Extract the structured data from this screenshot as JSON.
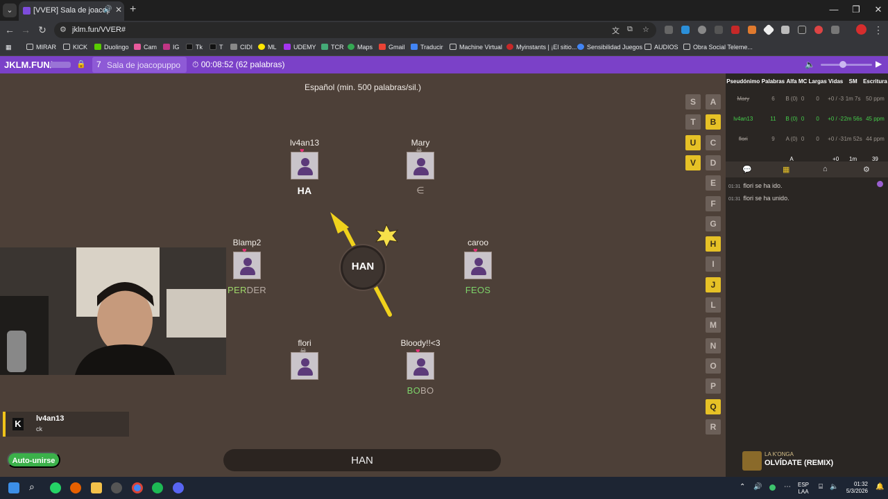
{
  "browser": {
    "tab_title": "[VVER] Sala de joacopuppo",
    "url": "jklm.fun/VVER#",
    "bookmarks": [
      "MIRAR",
      "KICK",
      "Duolingo",
      "Cam",
      "IG",
      "Tk",
      "T",
      "CIDI",
      "ML",
      "UDEMY",
      "TCR",
      "Maps",
      "Gmail",
      "Traducir",
      "Machine Virtual",
      "Myinstants | ¡El sitio...",
      "Sensibilidad Juegos",
      "AUDIOS",
      "Obra Social Teleme..."
    ]
  },
  "header": {
    "brand": "JKLM.FUN/",
    "room_number": "7",
    "room_name": "Sala de joacopuppo",
    "timer": "00:08:52 (62 palabras)"
  },
  "game": {
    "rule": "Español (min. 500 palabras/sil.)",
    "bomb_syllable": "HAN",
    "players": [
      {
        "name": "lv4an13",
        "status": "heart",
        "word_main": "HA",
        "word_rest": ""
      },
      {
        "name": "Mary",
        "status": "skull",
        "word_main": "",
        "word_rest": "∈"
      },
      {
        "name": "Blamp2",
        "status": "heart",
        "word_main": "PER",
        "word_rest": "DER"
      },
      {
        "name": "caroo",
        "status": "heart",
        "word_main": "FEOS",
        "word_rest": ""
      },
      {
        "name": "flori",
        "status": "skull",
        "word_main": "",
        "word_rest": ""
      },
      {
        "name": "Bloody!!<3",
        "status": "heart",
        "word_main": "BO",
        "word_rest": "BO"
      }
    ],
    "letters_left": [
      {
        "l": "S",
        "on": false
      },
      {
        "l": "T",
        "on": false
      },
      {
        "l": "U",
        "on": true
      },
      {
        "l": "V",
        "on": true
      }
    ],
    "letters_right": [
      {
        "l": "A",
        "on": false
      },
      {
        "l": "B",
        "on": true
      },
      {
        "l": "C",
        "on": false
      },
      {
        "l": "D",
        "on": false
      },
      {
        "l": "E",
        "on": false
      },
      {
        "l": "F",
        "on": false
      },
      {
        "l": "G",
        "on": false
      },
      {
        "l": "H",
        "on": true
      },
      {
        "l": "I",
        "on": false
      },
      {
        "l": "J",
        "on": true
      },
      {
        "l": "L",
        "on": false
      },
      {
        "l": "M",
        "on": false
      },
      {
        "l": "N",
        "on": false
      },
      {
        "l": "O",
        "on": false
      },
      {
        "l": "P",
        "on": false
      },
      {
        "l": "Q",
        "on": true
      },
      {
        "l": "R",
        "on": false
      }
    ],
    "input_value": "HAN",
    "auto_join": "Auto-unirse"
  },
  "notification": {
    "user": "lv4an13",
    "message": "ck"
  },
  "scoreboard": {
    "headers": [
      "Pseudónimo",
      "Palabras",
      "Alfa",
      "MC",
      "Largas",
      "Vidas",
      "SM",
      "Escritura"
    ],
    "rows": [
      {
        "name": "Mary",
        "words": "6",
        "alfa": "B (0)",
        "mc": "0",
        "largas": "0",
        "vidas": "+0 / -3",
        "sm": "1m 7s",
        "escritura": "50 ppm",
        "me": false,
        "dead": true
      },
      {
        "name": "lv4an13",
        "words": "11",
        "alfa": "B (0)",
        "mc": "0",
        "largas": "0",
        "vidas": "+0 / -2",
        "sm": "2m 56s",
        "escritura": "45 ppm",
        "me": true,
        "dead": false
      },
      {
        "name": "flori",
        "words": "9",
        "alfa": "A (0)",
        "mc": "0",
        "largas": "0",
        "vidas": "+0 / -3",
        "sm": "1m 52s",
        "escritura": "44 ppm",
        "me": false,
        "dead": true
      },
      {
        "name": "",
        "words": "",
        "alfa": "A",
        "mc": "",
        "largas": "",
        "vidas": "+0",
        "sm": "1m",
        "escritura": "39",
        "me": false,
        "dead": false
      }
    ]
  },
  "chat": [
    {
      "time": "01:31",
      "text": "flori se ha ido."
    },
    {
      "time": "01:31",
      "text": "flori se ha unido."
    }
  ],
  "now_playing": {
    "artist": "LA K'ONGA",
    "title": "OLVÍDATE (REMIX)"
  },
  "taskbar": {
    "lang_top": "ESP",
    "lang_bottom": "LAA",
    "time": "01:32",
    "date": "5/3/2026"
  },
  "colors": {
    "accent": "#7b41c8",
    "game_bg": "#4d4038",
    "highlight_letter": "#e6c126",
    "bomb_arrow": "#f0d21c",
    "ok_green": "#45d04c"
  }
}
